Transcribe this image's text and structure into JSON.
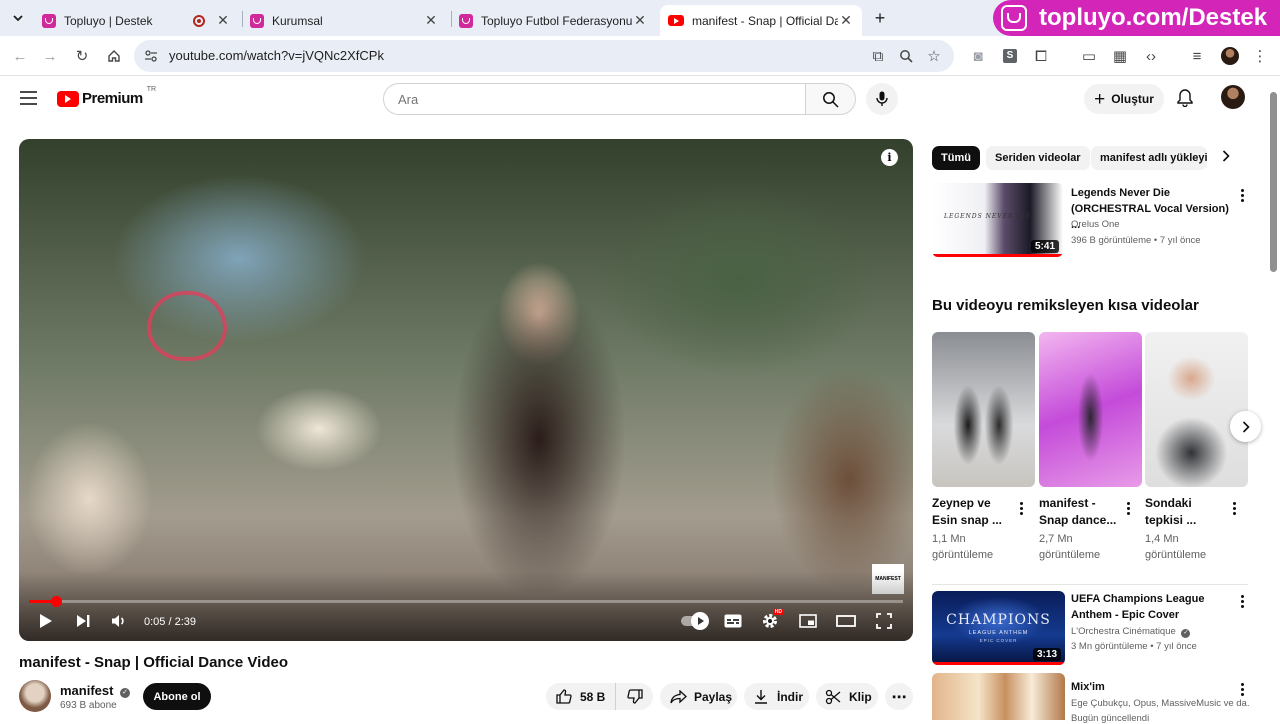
{
  "browser": {
    "tabs": [
      {
        "title": "Topluyo | Destek"
      },
      {
        "title": "Kurumsal"
      },
      {
        "title": "Topluyo Futbol Federasyonu"
      },
      {
        "title": "manifest - Snap | Official Dance Video"
      }
    ],
    "url": "youtube.com/watch?v=jVQNc2XfCPk",
    "promo": "topluyo.com/Destek"
  },
  "youtube": {
    "logo": "Premium",
    "logo_badge": "TR",
    "search_placeholder": "Ara",
    "create_label": "Oluştur"
  },
  "video": {
    "title": "manifest - Snap | Official Dance Video",
    "time": "0:05 / 2:39",
    "progress_fraction": 0.031,
    "watermark": "MANIFEST",
    "channel": "manifest",
    "subscribers": "693 B abone",
    "subscribe_label": "Abone ol",
    "likes": "58 B",
    "share_label": "Paylaş",
    "download_label": "İndir",
    "clip_label": "Klip"
  },
  "sidebar": {
    "chips": [
      "Tümü",
      "Seriden videolar",
      "manifest adlı yükleyici"
    ],
    "rec1": {
      "title_line1": "Legends Never Die",
      "title_line2": "(ORCHESTRAL Vocal Version) ...",
      "channel": "Orelus One",
      "meta": "396 B görüntüleme • 7 yıl önce",
      "duration": "5:41",
      "thumb_text": "LEGENDS NEVER DIE"
    },
    "shorts_heading": "Bu videoyu remiksleyen kısa videolar",
    "shorts": [
      {
        "title_line1": "Zeynep ve",
        "title_line2": "Esin snap ...",
        "views_line1": "1,1 Mn",
        "views_line2": "görüntüleme"
      },
      {
        "title_line1": "manifest -",
        "title_line2": "Snap dance...",
        "views_line1": "2,7 Mn",
        "views_line2": "görüntüleme"
      },
      {
        "title_line1": "Sondaki",
        "title_line2": "tepkisi ...",
        "views_line1": "1,4 Mn",
        "views_line2": "görüntüleme"
      }
    ],
    "rec2": {
      "title_line1": "UEFA Champions League",
      "title_line2": "Anthem - Epic Cover",
      "channel": "L'Orchestra Cinématique",
      "meta": "3 Mn görüntüleme • 7 yıl önce",
      "duration": "3:13",
      "thumb_text": "CHAMPIONS",
      "thumb_sub": "LEAGUE ANTHEM",
      "thumb_sub2": "EPIC COVER"
    },
    "rec3": {
      "title_line1": "Mix'im",
      "channel": "Ege Çubukçu, Opus, MassiveMusic ve da...",
      "meta": "Bugün güncellendi"
    }
  }
}
